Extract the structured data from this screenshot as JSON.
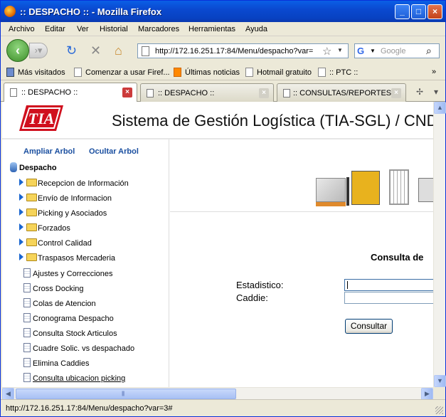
{
  "window": {
    "title": ":: DESPACHO :: - Mozilla Firefox"
  },
  "menu": [
    "Archivo",
    "Editar",
    "Ver",
    "Historial",
    "Marcadores",
    "Herramientas",
    "Ayuda"
  ],
  "nav": {
    "url": "http://172.16.251.17:84/Menu/despacho?var=",
    "search_placeholder": "Google"
  },
  "bookmarks": [
    "Más visitados",
    "Comenzar a usar Firef...",
    "Últimas noticias",
    "Hotmail gratuito",
    ":: PTC ::"
  ],
  "tabs": [
    {
      "label": ":: DESPACHO ::",
      "active": true
    },
    {
      "label": ":: DESPACHO ::",
      "active": false
    },
    {
      "label": ":: CONSULTAS/REPORTES ::",
      "active": false
    }
  ],
  "page": {
    "logo": "TIA",
    "system_title": "Sistema de Gestión Logística (TIA-SGL) / CND",
    "tree_expand": "Ampliar Arbol",
    "tree_hide": "Ocultar Arbol",
    "tree_root": "Despacho",
    "folders": [
      "Recepcion de Información",
      "Envío de Informacion",
      "Picking y Asociados",
      "Forzados",
      "Control Calidad",
      "Traspasos Mercaderia"
    ],
    "docs": [
      "Ajustes y Correcciones",
      "Cross Docking",
      "Colas de Atencion",
      "Cronograma Despacho",
      "Consulta Stock Articulos",
      "Cuadre Solic. vs despachado",
      "Elimina Caddies",
      "Consulta ubicacion picking"
    ],
    "form_title": "Consulta de",
    "label_estadistico": "Estadistico:",
    "label_caddie": "Caddie:",
    "button": "Consultar"
  },
  "status": "http://172.16.251.17:84/Menu/despacho?var=3#",
  "colors": {
    "titlebar": "#0842c2",
    "link": "#1a4fa0",
    "logo_red": "#d0101e"
  }
}
